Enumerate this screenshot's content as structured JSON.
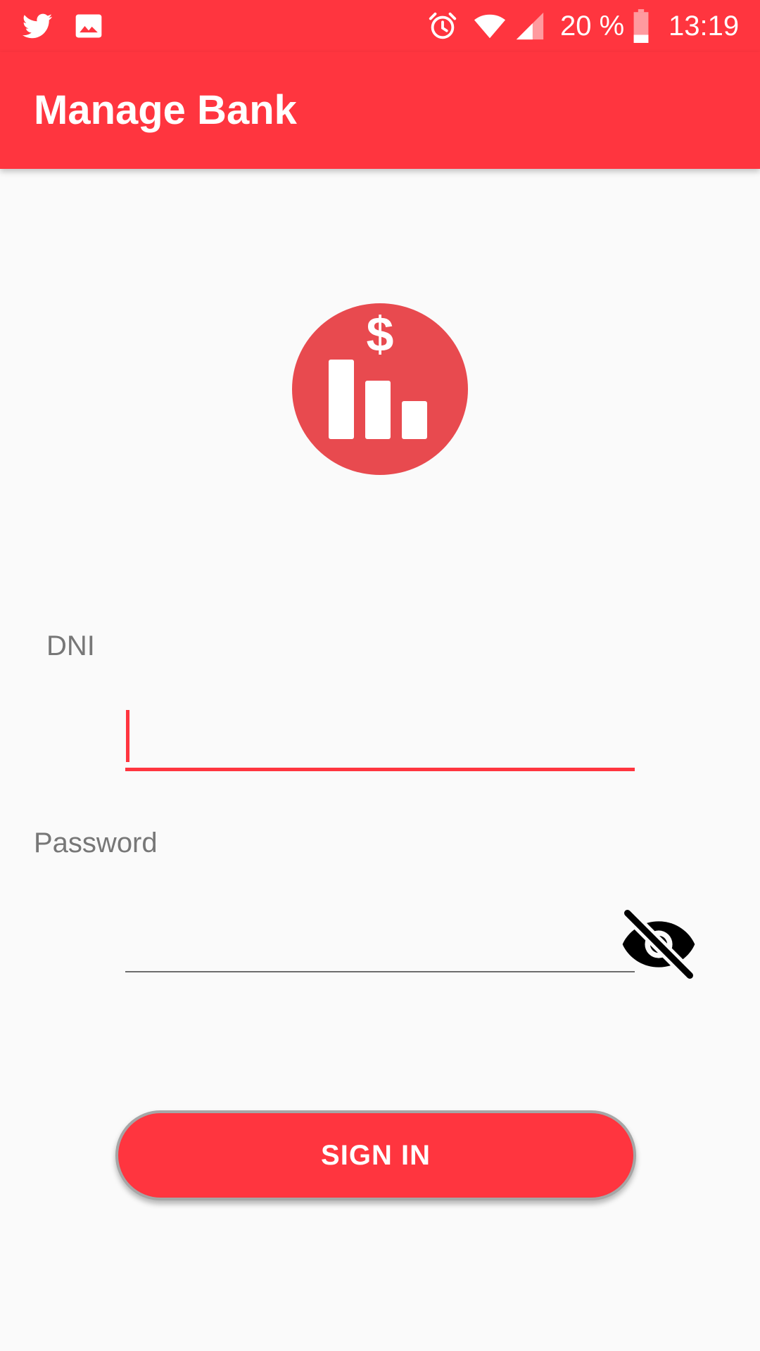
{
  "status_bar": {
    "notification_icons": [
      "twitter-icon",
      "image-icon"
    ],
    "system_icons": [
      "alarm-icon",
      "wifi-icon",
      "signal-icon",
      "battery-icon"
    ],
    "battery_text": "20 %",
    "time": "13:19"
  },
  "app_bar": {
    "title": "Manage Bank"
  },
  "logo": {
    "icon": "bank-money-chart-icon"
  },
  "form": {
    "dni": {
      "label": "DNI",
      "value": ""
    },
    "password": {
      "label": "Password",
      "value": "",
      "toggle_icon": "eye-off-icon"
    },
    "submit_label": "SIGN IN"
  },
  "colors": {
    "primary": "#ff353f",
    "background": "#fafafa",
    "logo": "#e84a4f",
    "label": "#777777"
  }
}
